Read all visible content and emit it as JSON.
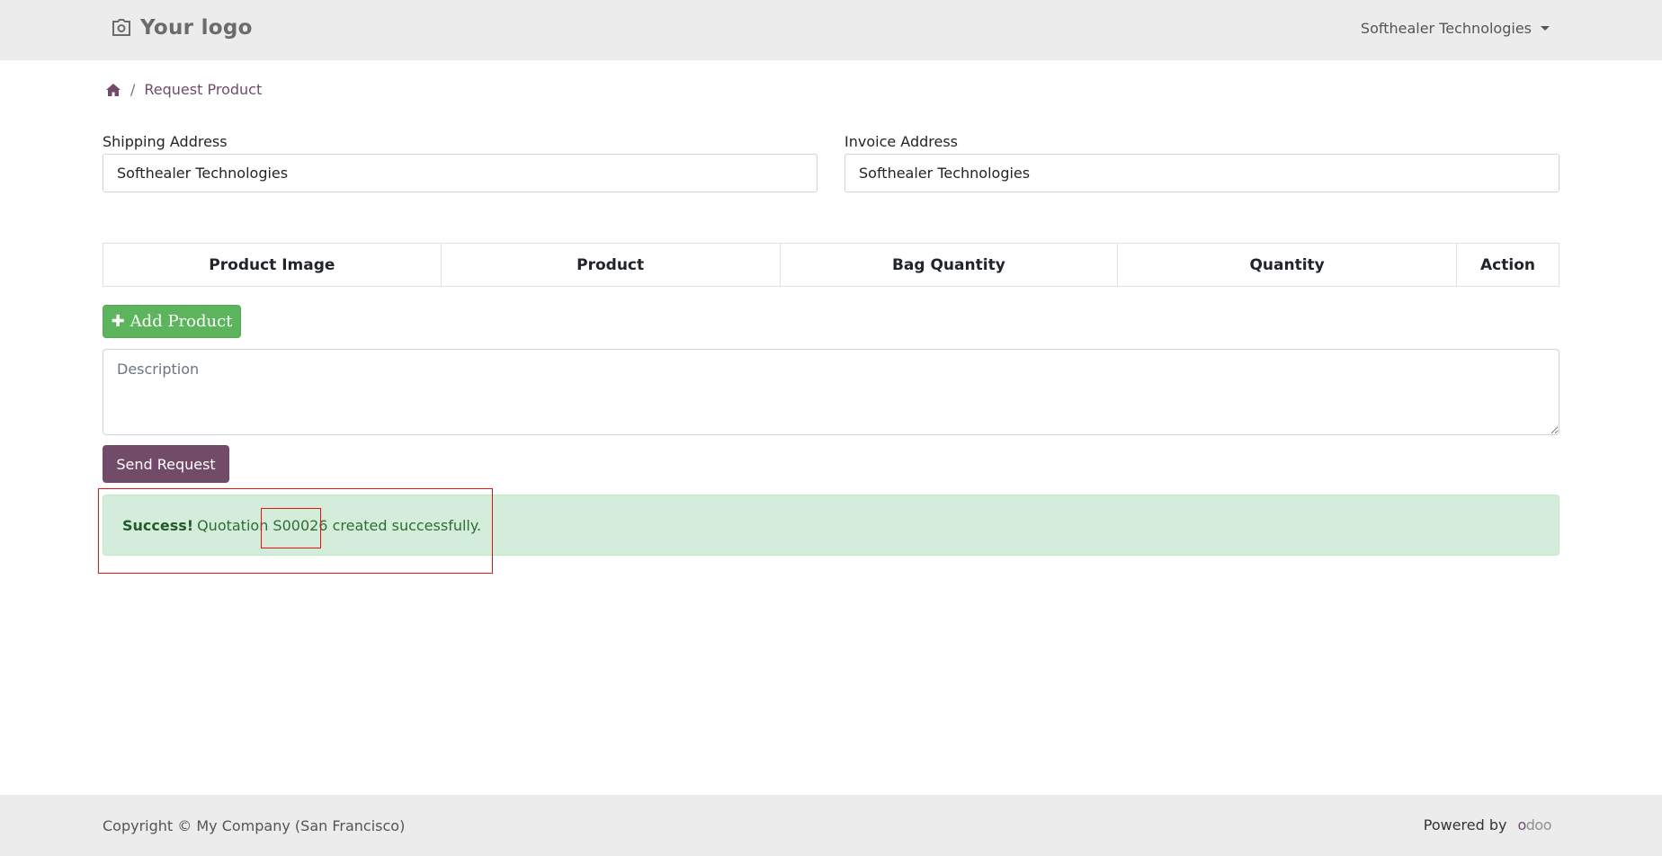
{
  "header": {
    "logo_text": "Your logo",
    "company_menu": "Softhealer Technologies"
  },
  "breadcrumb": {
    "current": "Request Product"
  },
  "form": {
    "shipping_label": "Shipping Address",
    "shipping_value": "Softhealer Technologies",
    "invoice_label": "Invoice Address",
    "invoice_value": "Softhealer Technologies",
    "table_headers": [
      "Product Image",
      "Product",
      "Bag Quantity",
      "Quantity",
      "Action"
    ],
    "add_product_label": "Add Product",
    "description_placeholder": "Description",
    "send_request_label": "Send Request"
  },
  "alert": {
    "strong": "Success!",
    "text_before": "Quotation",
    "order_ref": "S00026",
    "text_after": "created successfully."
  },
  "footer": {
    "copyright": "Copyright © My Company (San Francisco)",
    "powered_by": "Powered by",
    "brand_part1": "o",
    "brand_part2": "doo"
  },
  "colors": {
    "brand": "#714B67",
    "success_bg": "#d4edda",
    "add_button": "#5cb45c",
    "highlight": "#ee1111"
  }
}
